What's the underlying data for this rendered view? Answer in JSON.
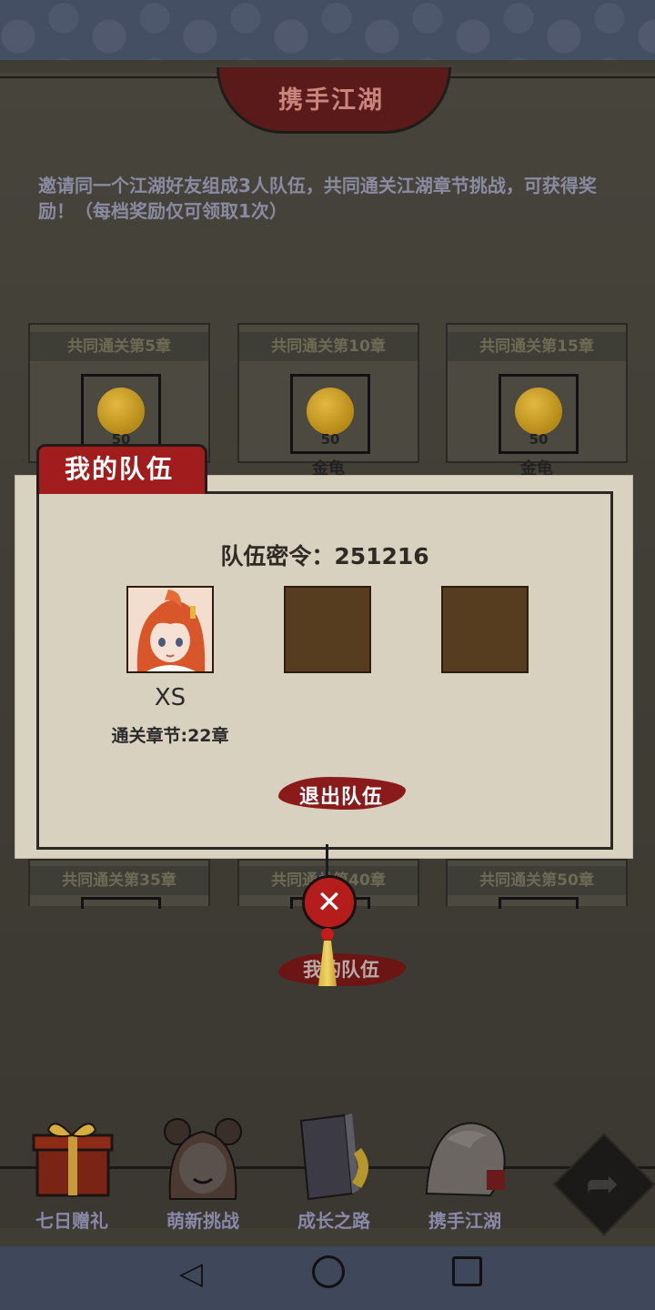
{
  "header": {
    "title": "携手江湖"
  },
  "description": "邀请同一个江湖好友组成3人队伍，共同通关江湖章节挑战，可获得奖励！（每档奖励仅可领取1次）",
  "rewards_top": [
    {
      "label": "共同通关第5章",
      "count": "50",
      "name": ""
    },
    {
      "label": "共同通关第10章",
      "count": "50",
      "name": "金龟"
    },
    {
      "label": "共同通关第15章",
      "count": "50",
      "name": "金龟"
    }
  ],
  "rewards_bottom": [
    {
      "label": "共同通关第35章"
    },
    {
      "label": "共同通关第40章"
    },
    {
      "label": "共同通关第50章"
    }
  ],
  "team_popup": {
    "tab_title": "我的队伍",
    "code_text": "队伍密令：251216",
    "member": {
      "name": "XS",
      "progress": "通关章节:22章"
    },
    "leave_label": "退出队伍",
    "close_symbol": "✕"
  },
  "my_team_label": "我的队伍",
  "bottom_nav": [
    {
      "label": "七日赠礼",
      "icon": "gift-box-icon"
    },
    {
      "label": "萌新挑战",
      "icon": "girl-avatar-icon"
    },
    {
      "label": "成长之路",
      "icon": "book-icon"
    },
    {
      "label": "携手江湖",
      "icon": "handshake-icon"
    }
  ],
  "share_symbol": "➦",
  "colors": {
    "accent_red": "#a11c1c",
    "gold": "#d6b53a",
    "paper": "#d8d1bf"
  }
}
